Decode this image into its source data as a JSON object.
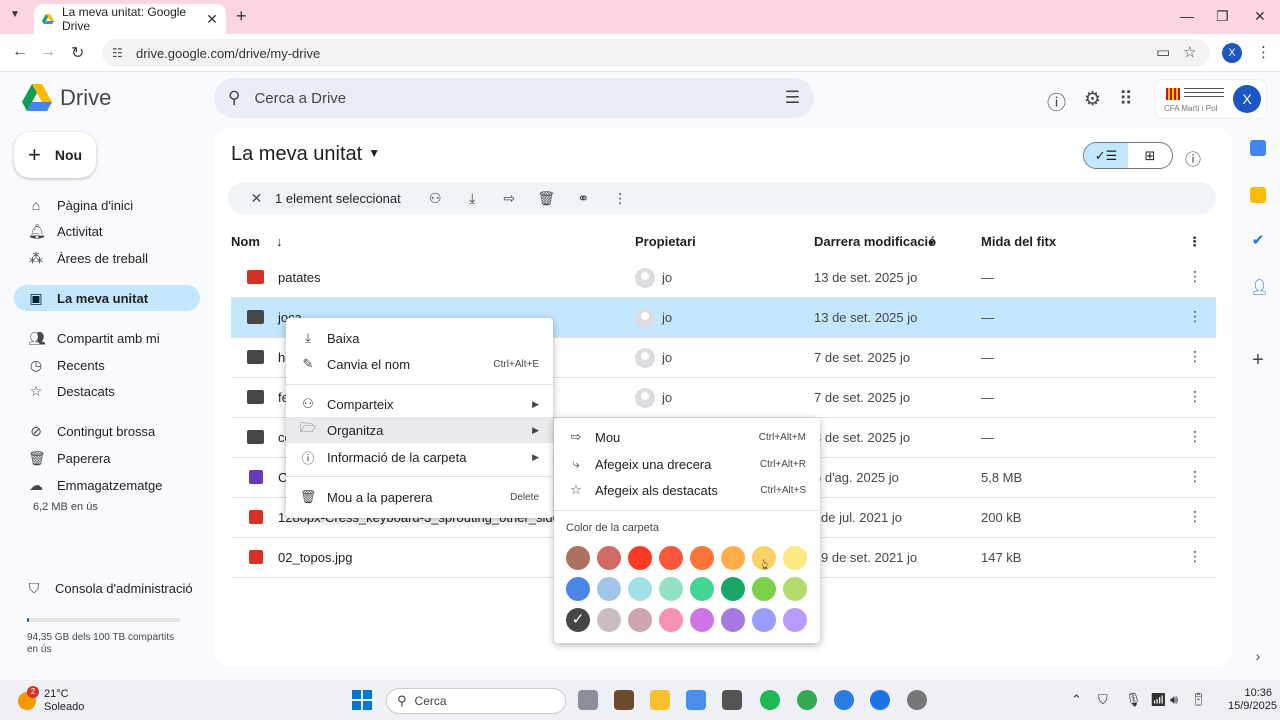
{
  "browser": {
    "tab_title": "La meva unitat: Google Drive",
    "url": "drive.google.com/drive/my-drive",
    "profile_initial": "X"
  },
  "app": {
    "name": "Drive",
    "search_placeholder": "Cerca a Drive",
    "org_text": "CFA Martí i Pol",
    "user_initial": "X"
  },
  "sidebar": {
    "new_label": "Nou",
    "items": [
      {
        "label": "Pàgina d'inici",
        "icon": "home-icon"
      },
      {
        "label": "Activitat",
        "icon": "bell-icon"
      },
      {
        "label": "Àrees de treball",
        "icon": "workspaces-icon"
      },
      {
        "label": "La meva unitat",
        "icon": "drive-icon"
      },
      {
        "label": "Compartit amb mi",
        "icon": "people-icon"
      },
      {
        "label": "Recents",
        "icon": "clock-icon"
      },
      {
        "label": "Destacats",
        "icon": "star-icon"
      },
      {
        "label": "Contingut brossa",
        "icon": "spam-icon"
      },
      {
        "label": "Paperera",
        "icon": "trash-icon"
      },
      {
        "label": "Emmagatzematge",
        "icon": "cloud-icon"
      }
    ],
    "storage_used": "6,2 MB en ús",
    "admin_label": "Consola d'administració",
    "quota_text": "94,35 GB dels 100 TB compartits en ús",
    "quota_fraction": 0.01
  },
  "main": {
    "title": "La meva unitat",
    "selection_text": "1 element seleccionat",
    "columns": {
      "name": "Nom",
      "owner": "Propietari",
      "modified": "Darrera modificació",
      "size": "Mida del fitx"
    },
    "rows": [
      {
        "name": "patates",
        "type": "folder-red",
        "owner": "jo",
        "modified": "13 de set. 2025 jo",
        "size": "—"
      },
      {
        "name": "joca",
        "type": "folder",
        "owner": "jo",
        "modified": "13 de set. 2025 jo",
        "size": "—"
      },
      {
        "name": "he",
        "type": "folder",
        "owner": "jo",
        "modified": "7 de set. 2025 jo",
        "size": "—"
      },
      {
        "name": "fe",
        "type": "folder",
        "owner": "jo",
        "modified": "7 de set. 2025 jo",
        "size": "—"
      },
      {
        "name": "co",
        "type": "shared-folder",
        "owner": "",
        "modified": "3 de set. 2025 jo",
        "size": "—"
      },
      {
        "name": "C",
        "type": "form",
        "owner": "",
        "modified": "6 d'ag. 2025 jo",
        "size": "5,8 MB"
      },
      {
        "name": "1280px-Cress_keyboard-3_sprouting_other_side.jp",
        "type": "image",
        "owner": "",
        "modified": "de jul. 2021 jo",
        "size": "200 kB"
      },
      {
        "name": "02_topos.jpg",
        "type": "image",
        "owner": "",
        "modified": "9 de set. 2021 jo",
        "size": "147 kB"
      }
    ]
  },
  "context_menu": {
    "items": [
      {
        "label": "Baixa",
        "shortcut": "",
        "icon": "download-icon"
      },
      {
        "label": "Canvia el nom",
        "shortcut": "Ctrl+Alt+E",
        "icon": "edit-icon"
      },
      {
        "label": "Comparteix",
        "shortcut": "",
        "icon": "share-icon"
      },
      {
        "label": "Organitza",
        "shortcut": "",
        "icon": "folder-move-icon"
      },
      {
        "label": "Informació de la carpeta",
        "shortcut": "",
        "icon": "info-icon"
      },
      {
        "label": "Mou a la paperera",
        "shortcut": "Delete",
        "icon": "trash-icon"
      }
    ]
  },
  "submenu": {
    "items": [
      {
        "label": "Mou",
        "shortcut": "Ctrl+Alt+M"
      },
      {
        "label": "Afegeix una drecera",
        "shortcut": "Ctrl+Alt+R"
      },
      {
        "label": "Afegeix als destacats",
        "shortcut": "Ctrl+Alt+S"
      }
    ],
    "color_title": "Color de la carpeta",
    "colors": [
      "#ac725e",
      "#d06b64",
      "#f83a22",
      "#fa573c",
      "#ff7537",
      "#ffad46",
      "#fad165",
      "#fbe983",
      "#4986e7",
      "#9fc6e7",
      "#9fe1e7",
      "#92e1c0",
      "#42d692",
      "#16a765",
      "#7bd148",
      "#b3dc6c",
      "#444746",
      "#cabdbf",
      "#cca6ac",
      "#f691b2",
      "#cd74e6",
      "#a47ae2",
      "#9a9cff",
      "#b99aff"
    ],
    "checked_index": 16
  },
  "taskbar": {
    "temperature": "21°C",
    "weather": "Soleado",
    "weather_badge": "2",
    "search_label": "Cerca",
    "time": "10:36",
    "date": "15/9/2025"
  }
}
